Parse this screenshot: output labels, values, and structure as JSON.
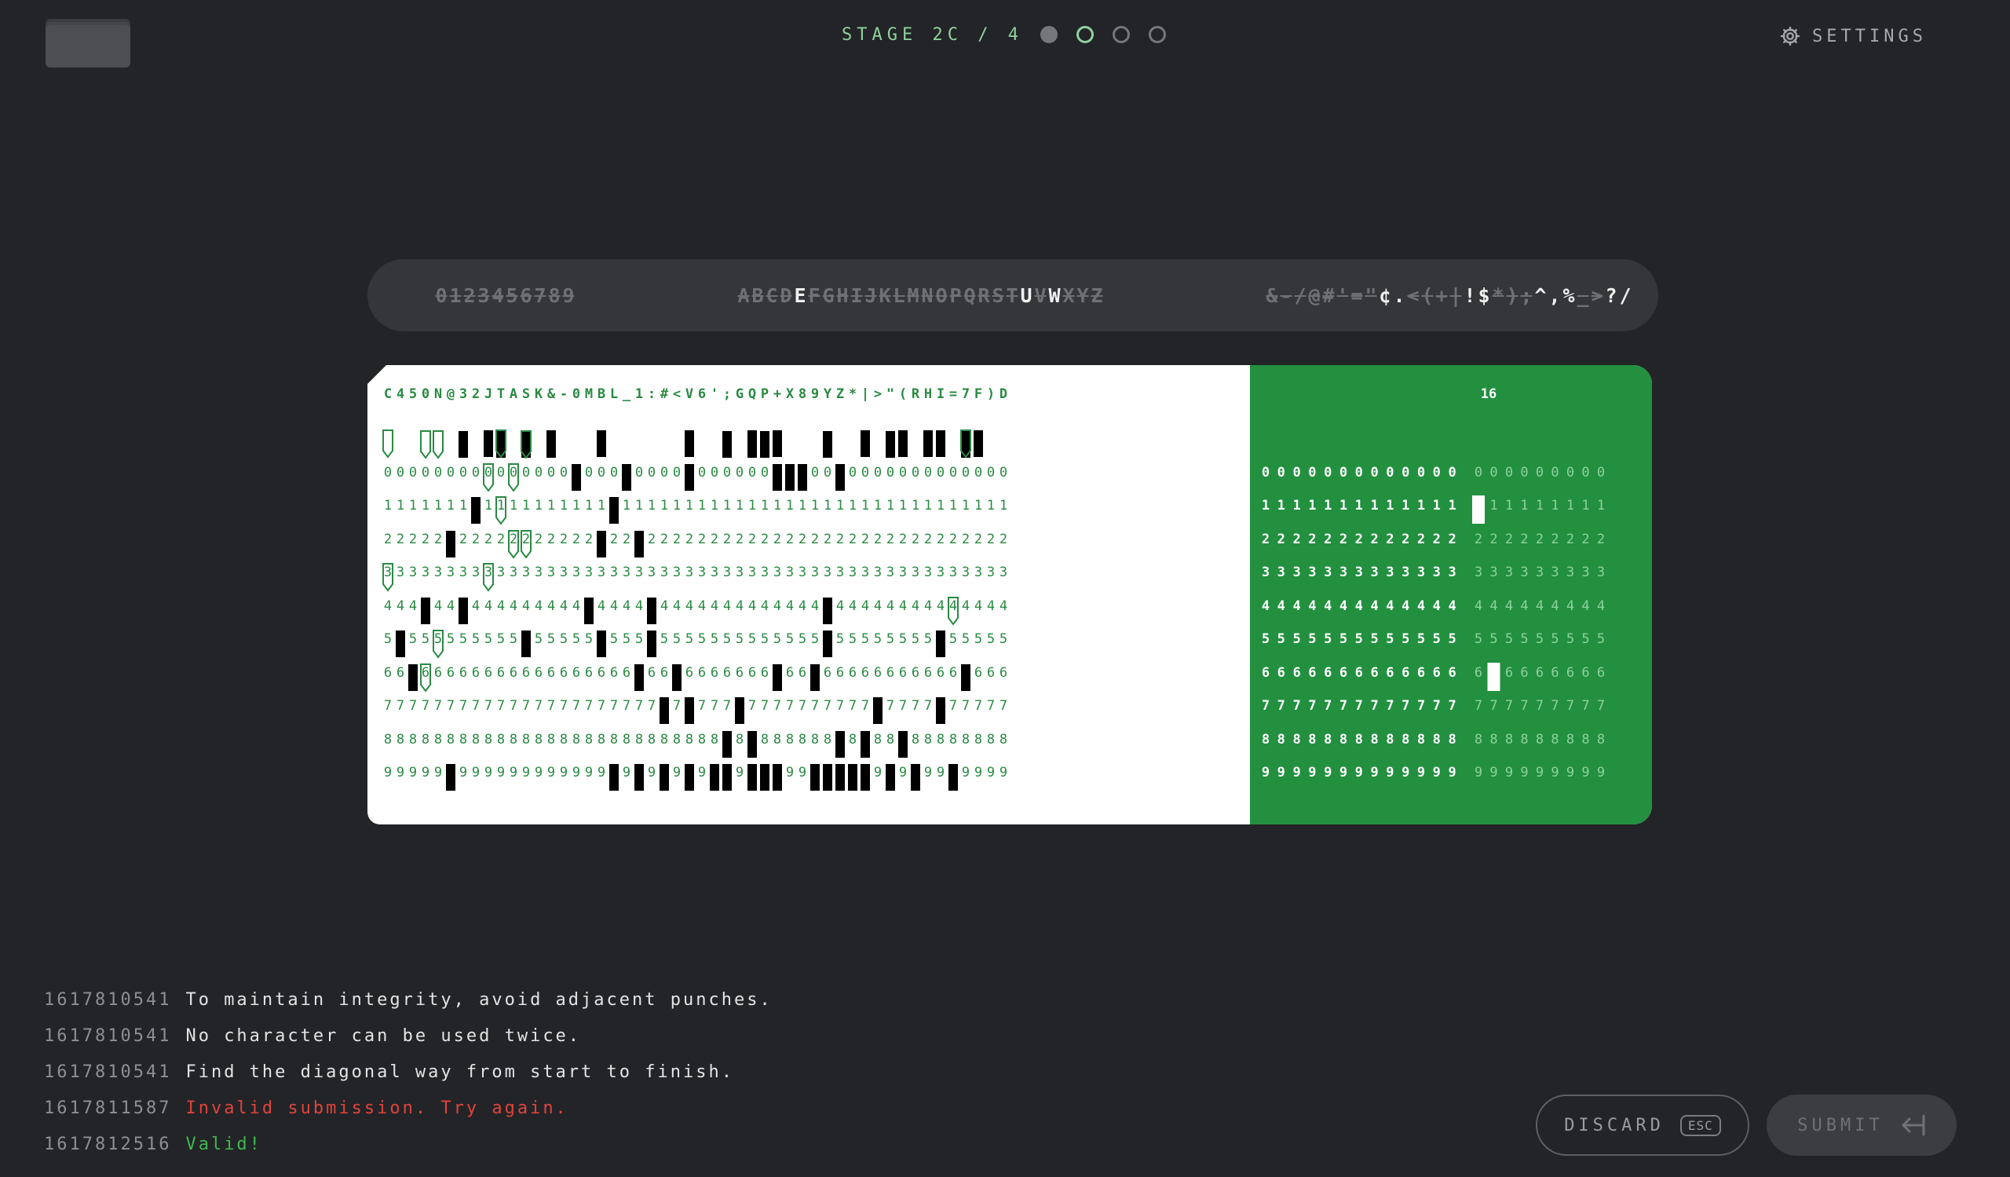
{
  "header": {
    "stage_label": "STAGE 2C / 4",
    "stages": [
      "done",
      "current",
      "todo",
      "todo"
    ],
    "settings_label": "SETTINGS"
  },
  "charbar": {
    "groups": [
      [
        {
          "c": "0",
          "u": true
        },
        {
          "c": "1",
          "u": true
        },
        {
          "c": "2",
          "u": true
        },
        {
          "c": "3",
          "u": true
        },
        {
          "c": "4",
          "u": true
        },
        {
          "c": "5",
          "u": true
        },
        {
          "c": "6",
          "u": true
        },
        {
          "c": "7",
          "u": true
        },
        {
          "c": "8",
          "u": true
        },
        {
          "c": "9",
          "u": true
        }
      ],
      [
        {
          "c": "A",
          "u": true
        },
        {
          "c": "B",
          "u": true
        },
        {
          "c": "C",
          "u": true
        },
        {
          "c": "D",
          "u": true
        },
        {
          "c": "E",
          "u": false
        },
        {
          "c": "F",
          "u": true
        },
        {
          "c": "G",
          "u": true
        },
        {
          "c": "H",
          "u": true
        },
        {
          "c": "I",
          "u": true
        },
        {
          "c": "J",
          "u": true
        },
        {
          "c": "K",
          "u": true
        },
        {
          "c": "L",
          "u": true
        },
        {
          "c": "M",
          "u": true
        },
        {
          "c": "N",
          "u": true
        },
        {
          "c": "O",
          "u": true
        },
        {
          "c": "P",
          "u": true
        },
        {
          "c": "Q",
          "u": true
        },
        {
          "c": "R",
          "u": true
        },
        {
          "c": "S",
          "u": true
        },
        {
          "c": "T",
          "u": true
        },
        {
          "c": "U",
          "u": false
        },
        {
          "c": "V",
          "u": true
        },
        {
          "c": "W",
          "u": false
        },
        {
          "c": "X",
          "u": true
        },
        {
          "c": "Y",
          "u": true
        },
        {
          "c": "Z",
          "u": true
        }
      ],
      [
        {
          "c": "&",
          "u": true
        },
        {
          "c": "-",
          "u": true
        },
        {
          "c": "/",
          "u": true
        },
        {
          "c": "@",
          "u": true
        },
        {
          "c": "#",
          "u": true
        },
        {
          "c": "'",
          "u": true
        },
        {
          "c": "=",
          "u": true
        },
        {
          "c": "\"",
          "u": true
        },
        {
          "c": "¢",
          "u": false
        },
        {
          "c": ".",
          "u": false
        },
        {
          "c": "<",
          "u": true
        },
        {
          "c": "(",
          "u": true
        },
        {
          "c": "+",
          "u": true
        },
        {
          "c": "|",
          "u": true
        },
        {
          "c": "!",
          "u": false
        },
        {
          "c": "$",
          "u": false
        },
        {
          "c": "*",
          "u": true
        },
        {
          "c": ")",
          "u": true
        },
        {
          "c": ";",
          "u": true
        },
        {
          "c": "^",
          "u": false
        },
        {
          "c": ",",
          "u": false
        },
        {
          "c": "%",
          "u": false
        },
        {
          "c": "_",
          "u": true
        },
        {
          "c": ">",
          "u": true
        },
        {
          "c": "?",
          "u": false
        },
        {
          "c": "/",
          "u": false
        }
      ]
    ]
  },
  "card": {
    "header_text": "C450N@32JTASK&-0MBL_1:#<V6';GQP+X89YZ*|>\"(RHI=7F)D",
    "header_right": "16",
    "digit_rows": [
      "0",
      "1",
      "2",
      "3",
      "4",
      "5",
      "6",
      "7",
      "8",
      "9"
    ]
  },
  "log": [
    {
      "ts": "1617810541",
      "msg": "To maintain integrity, avoid adjacent punches.",
      "type": "info"
    },
    {
      "ts": "1617810541",
      "msg": "No character can be used twice.",
      "type": "info"
    },
    {
      "ts": "1617810541",
      "msg": "Find the diagonal way from start to finish.",
      "type": "info"
    },
    {
      "ts": "1617811587",
      "msg": "Invalid submission. Try again.",
      "type": "error"
    },
    {
      "ts": "1617812516",
      "msg": "Valid!",
      "type": "success"
    }
  ],
  "buttons": {
    "discard_label": "DISCARD",
    "discard_key": "ESC",
    "submit_label": "SUBMIT"
  }
}
